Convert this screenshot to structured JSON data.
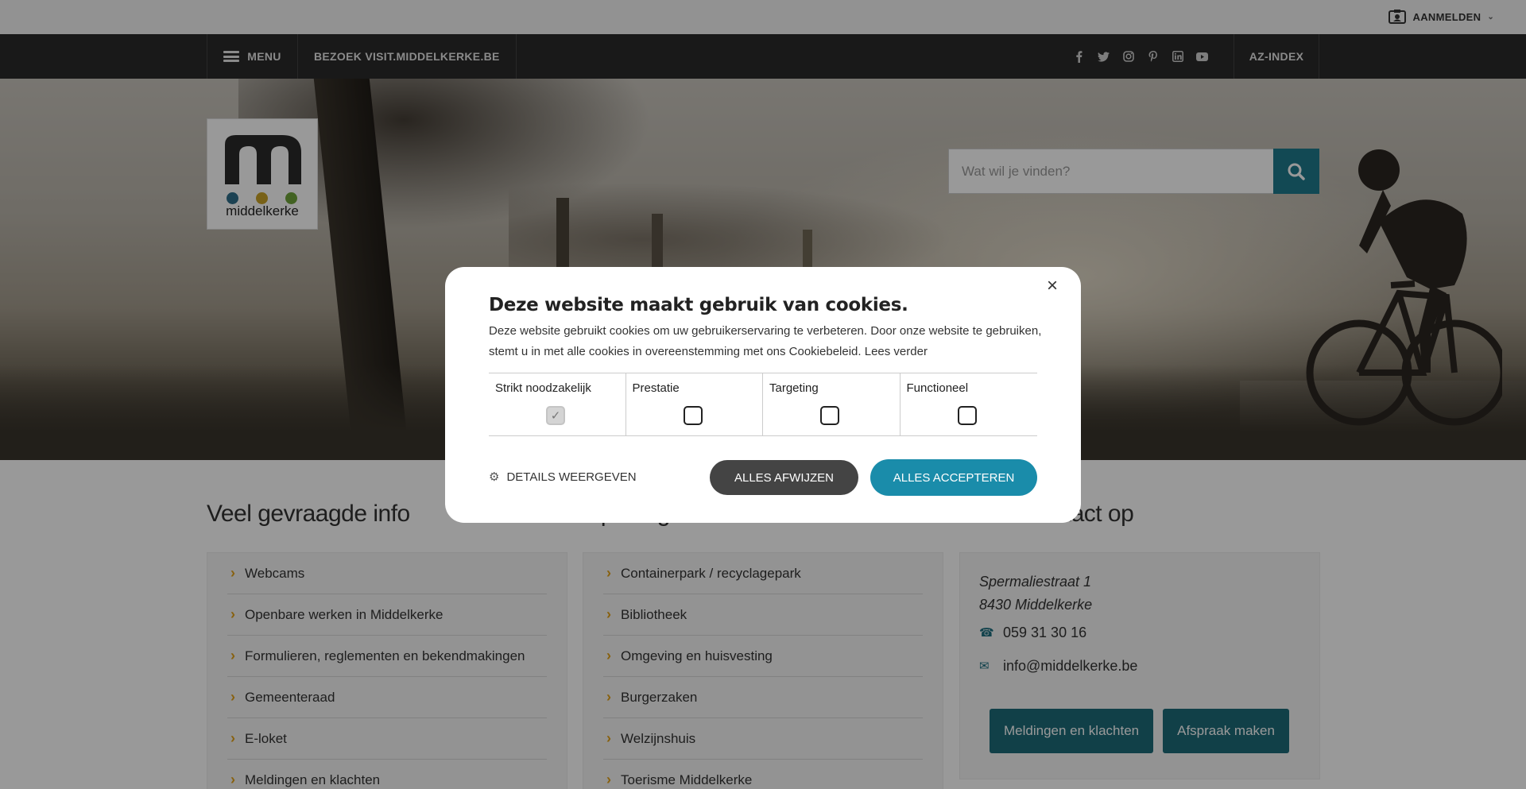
{
  "topbar": {
    "login_label": "AANMELDEN"
  },
  "nav": {
    "menu_label": "MENU",
    "visit_label": "BEZOEK VISIT.MIDDELKERKE.BE",
    "socials": [
      "f",
      "t",
      "ig",
      "p",
      "in",
      "yt"
    ],
    "az_label": "AZ-INDEX"
  },
  "logo": {
    "word": "middelkerke",
    "dot_colors": [
      "#2f6f8a",
      "#c9a227",
      "#6fa33a"
    ]
  },
  "search": {
    "placeholder": "Wat wil je vinden?"
  },
  "sections": {
    "faq_title": "Veel gevraagde info",
    "hours_title": "Openingsuren en adressen",
    "contact_title": "Neem contact op",
    "faq_items": [
      "Webcams",
      "Openbare werken in Middelkerke",
      "Formulieren, reglementen en bekendmakingen",
      "Gemeenteraad",
      "E-loket",
      "Meldingen en klachten"
    ],
    "hours_items": [
      "Containerpark / recyclagepark",
      "Bibliotheek",
      "Omgeving en huisvesting",
      "Burgerzaken",
      "Welzijnshuis",
      "Toerisme Middelkerke"
    ],
    "contact": {
      "street": "Spermaliestraat 1",
      "city": "8430 Middelkerke",
      "phone": "059 31 30 16",
      "email": "info@middelkerke.be",
      "btn_reports": "Meldingen en klachten",
      "btn_appointment": "Afspraak maken"
    }
  },
  "cookie": {
    "title": "Deze website maakt gebruik van cookies.",
    "desc": "Deze website gebruikt cookies om uw gebruikerservaring te verbeteren. Door onze website te gebruiken, stemt u in met alle cookies in overeenstemming met ons Cookiebeleid.",
    "read_more": "Lees verder",
    "categories": [
      {
        "label": "Strikt noodzakelijk",
        "checked": true
      },
      {
        "label": "Prestatie",
        "checked": false
      },
      {
        "label": "Targeting",
        "checked": false
      },
      {
        "label": "Functioneel",
        "checked": false
      }
    ],
    "details_label": "DETAILS WEERGEVEN",
    "reject_label": "ALLES AFWIJZEN",
    "accept_label": "ALLES ACCEPTEREN"
  }
}
